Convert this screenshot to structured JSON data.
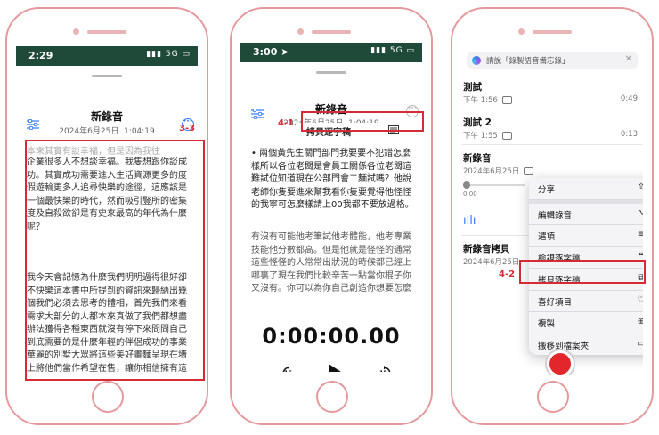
{
  "phone1": {
    "status_time": "2:29",
    "status_right": "5G",
    "title": "新錄音",
    "date": "2024年6月25日",
    "time": "1:04:19",
    "step": "3-3",
    "transcript_top": "本來其實有談幸福，但是因為我往",
    "transcript_p1": "企業很多人不想談幸福。我隻想跟你談成功。其實成功需要進入生活資源更多的度假遊輪更多人追尋快樂的途徑，這應該是一個最快樂的時代，然而吸引豎所的密集度及自殺欲卻是有史來最高的年代為什麼呢？",
    "transcript_p2": "我今天會記憶為什麼我們明明過得很好卻不快樂這本書中所提到的資訊來歸納出幾個我們必須去思考的體相，首先我們來看需求大部分的人都本來真做了我們都想盡辦法獲得各種東西就沒有停下來問問自己到底需要的是什麼年輕的伴侶成功的事業華麗的別墅大眾將這些美好畫麵呈現在墻上將他們當作希望在售，讓你相信擁有這些東西會帶來幸福，然而這其中就少數女人的需求有關，在現今社會中"
  },
  "phone2": {
    "status_time": "3:00",
    "status_right": "5G",
    "title": "新錄音",
    "date": "2024年6月25日",
    "time": "1:04:19",
    "step": "4-1",
    "copy_label": "拷貝逐字稿",
    "transcript_p1": "• 兩個黃先生關門部門我要要不犯錯怎麼樣所以各位老闆是會員工關係各位老闆這難試位知道現在公部門會二麵試嗎？他說老師你隻要進來幫我看你隻要覺得他怪怪的我寧可怎麼樣請上00我都不要放過格。",
    "transcript_p2": "有沒有可能他考筆試他考體能，他考專業技能他分數都高。但是他就是怪怪的通常這些怪怪的人常常出狀況的時候都已經上哪裏了現在我們比較辛苦一點當你棍子你又沒有。你可以為你自己創造你想要怎麼來",
    "timer": "0:00:00.00",
    "skip_back": "15",
    "skip_fwd": "15"
  },
  "phone3": {
    "siri_text": "請說「錄製語音備忘錄」",
    "items": [
      {
        "name": "測試",
        "meta": "下午 1:56",
        "dur": "0:49"
      },
      {
        "name": "測試 2",
        "meta": "下午 1:55",
        "dur": "0:13"
      },
      {
        "name": "新錄音",
        "meta": "2024年6月25日",
        "dur": ""
      },
      {
        "name": "新錄音拷貝",
        "meta": "2024年6月25日",
        "dur": ""
      }
    ],
    "progress_start": "0:00",
    "step": "4-2",
    "menu": [
      {
        "label": "分享",
        "icon": "⇪"
      },
      {
        "label": "編輯錄音",
        "icon": "∿"
      },
      {
        "label": "選項",
        "icon": "≡"
      },
      {
        "label": "檢視逐字稿",
        "icon": "❝"
      },
      {
        "label": "拷貝逐字稿",
        "icon": "⧉"
      },
      {
        "label": "喜好項目",
        "icon": "♡"
      },
      {
        "label": "複製",
        "icon": "⊕"
      },
      {
        "label": "搬移到檔案夾",
        "icon": "▭"
      }
    ]
  },
  "colors": {
    "frame": "#e5999c",
    "highlight": "#d62b35",
    "accent": "#2f7bf6",
    "record": "#e3262c"
  }
}
